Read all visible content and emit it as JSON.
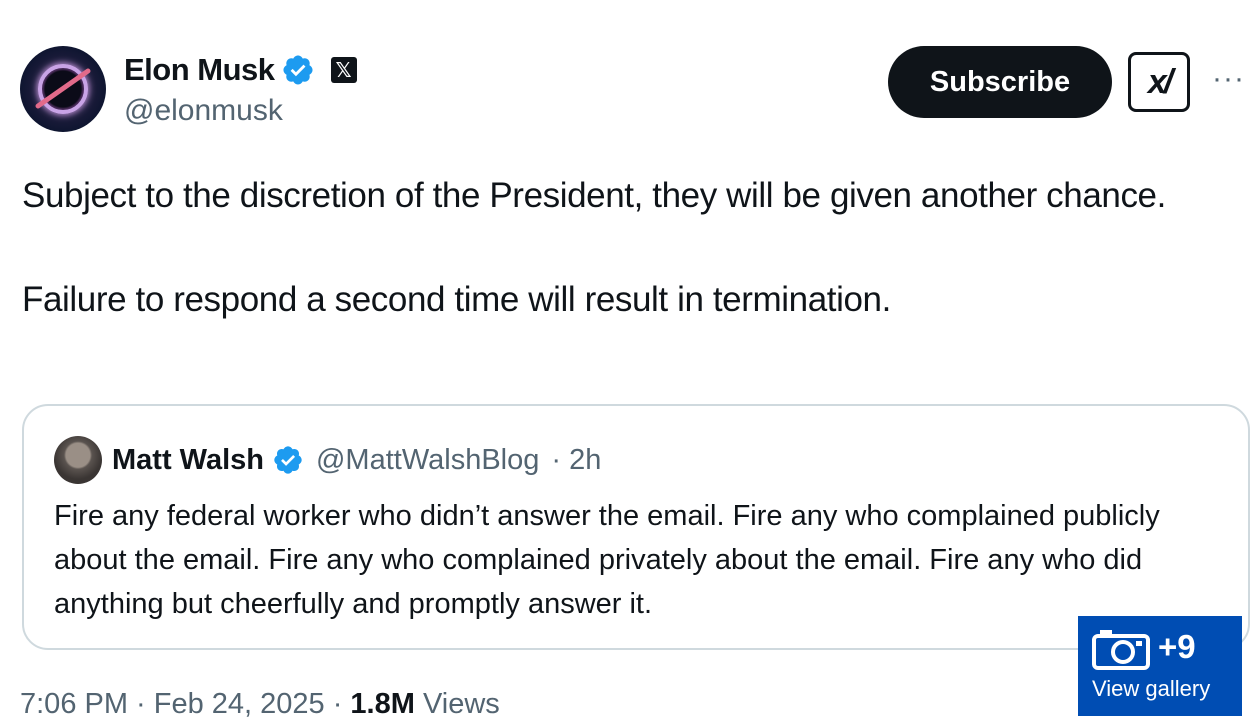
{
  "author": {
    "name": "Elon Musk",
    "handle": "@elonmusk",
    "verified": true,
    "affiliation_icon": "x-logo-icon"
  },
  "actions": {
    "subscribe_label": "Subscribe",
    "grok_label": "x/",
    "more_label": "···"
  },
  "tweet": {
    "paragraph_1": "Subject to the discretion of the President, they will be given another chance.",
    "paragraph_2": "Failure to respond a second time will result in termination."
  },
  "quote": {
    "name": "Matt Walsh",
    "handle": "@MattWalshBlog",
    "time": "· 2h",
    "text": "Fire any federal worker who didn’t answer the email. Fire any who complained publicly about the email. Fire any who complained privately about the email. Fire any who did anything but cheerfully and promptly answer it."
  },
  "meta": {
    "time_date": "7:06 PM · Feb 24, 2025 ·",
    "views_count": "1.8M",
    "views_label": "Views"
  },
  "gallery": {
    "count_label": "+9",
    "label": "View gallery"
  },
  "colors": {
    "verified_blue": "#1d9bf0",
    "gallery_blue": "#004db3",
    "secondary_text": "#536471"
  }
}
